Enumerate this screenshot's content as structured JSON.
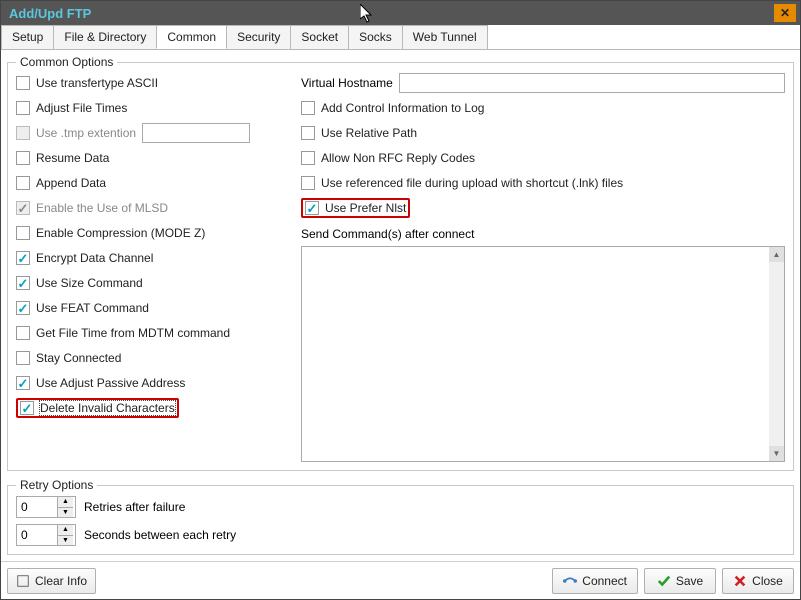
{
  "window": {
    "title": "Add/Upd FTP"
  },
  "tabs": [
    "Setup",
    "File & Directory",
    "Common",
    "Security",
    "Socket",
    "Socks",
    "Web Tunnel"
  ],
  "active_tab_index": 2,
  "common_options": {
    "title": "Common Options",
    "left": [
      {
        "label": "Use transfertype ASCII",
        "checked": false,
        "disabled": false
      },
      {
        "label": "Adjust File Times",
        "checked": false,
        "disabled": false
      },
      {
        "label": "Use .tmp extention",
        "checked": false,
        "disabled": true,
        "has_input": true,
        "input_value": ""
      },
      {
        "label": "Resume Data",
        "checked": false,
        "disabled": false
      },
      {
        "label": "Append Data",
        "checked": false,
        "disabled": false
      },
      {
        "label": "Enable the Use of MLSD",
        "checked": true,
        "disabled": true
      },
      {
        "label": "Enable Compression (MODE Z)",
        "checked": false,
        "disabled": false
      },
      {
        "label": "Encrypt Data Channel",
        "checked": true,
        "disabled": false
      },
      {
        "label": "Use Size Command",
        "checked": true,
        "disabled": false
      },
      {
        "label": "Use FEAT Command",
        "checked": true,
        "disabled": false
      },
      {
        "label": "Get File Time from MDTM command",
        "checked": false,
        "disabled": false
      },
      {
        "label": "Stay Connected",
        "checked": false,
        "disabled": false
      },
      {
        "label": "Use Adjust Passive Address",
        "checked": true,
        "disabled": false
      },
      {
        "label": "Delete Invalid Characters",
        "checked": true,
        "disabled": false,
        "highlight": true,
        "focus": true
      }
    ],
    "right": {
      "virtual_hostname_label": "Virtual Hostname",
      "virtual_hostname_value": "",
      "items": [
        {
          "label": "Add Control Information to Log",
          "checked": false
        },
        {
          "label": "Use Relative Path",
          "checked": false
        },
        {
          "label": "Allow Non RFC Reply Codes",
          "checked": false
        },
        {
          "label": "Use referenced file during upload with shortcut (.lnk) files",
          "checked": false
        },
        {
          "label": "Use Prefer Nlst",
          "checked": true,
          "highlight": true
        }
      ],
      "send_command_label": "Send Command(s) after connect",
      "send_command_value": ""
    }
  },
  "retry_options": {
    "title": "Retry Options",
    "rows": [
      {
        "value": "0",
        "label": "Retries after failure"
      },
      {
        "value": "0",
        "label": "Seconds between each retry"
      }
    ]
  },
  "footer": {
    "clear_info": "Clear Info",
    "connect": "Connect",
    "save": "Save",
    "close": "Close"
  },
  "icons": {
    "close_x": "✕",
    "check": "✓",
    "connect": "connect-icon",
    "save": "save-icon",
    "close_btn": "close-icon",
    "clear": "clear-icon"
  }
}
